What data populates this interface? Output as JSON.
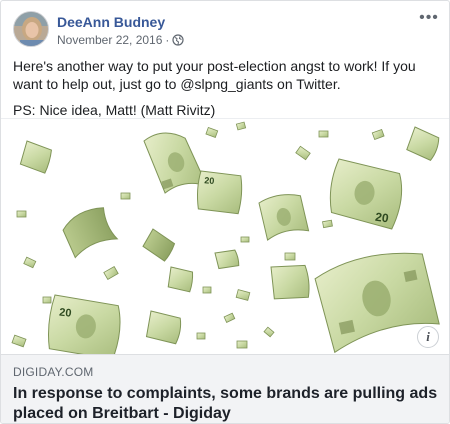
{
  "post": {
    "author": "DeeAnn Budney",
    "date": "November 22, 2016",
    "separator": "·",
    "privacy_icon": "globe-icon",
    "more_icon": "more-options-icon",
    "text_line1": "Here's another way to put your post-election angst to work! If you want to help out, just go to @slpng_giants on Twitter.",
    "text_line2": "PS: Nice idea, Matt! (Matt Rivitz)"
  },
  "attachment": {
    "image_subject": "falling-dollar-bills-image",
    "info_label": "i",
    "domain": "DIGIDAY.COM",
    "headline": "In response to complaints, some brands are pulling ads placed on Breitbart - Digiday"
  },
  "colors": {
    "author_link": "#385898",
    "secondary_text": "#606770",
    "link_box_bg": "#f2f3f5",
    "bill_green": "#c9d9a3"
  }
}
